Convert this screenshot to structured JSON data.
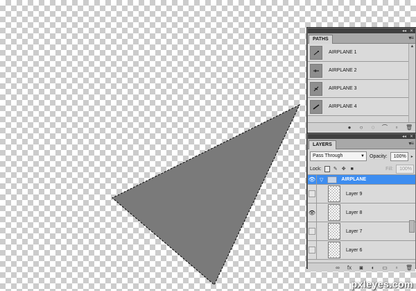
{
  "canvas": {
    "shape_fill": "#7a7a7a",
    "selection_border": "marching-ants"
  },
  "paths_panel": {
    "tab_label": "PATHS",
    "top_icons": "◂◂ ✕",
    "menu_icon": "▾≡",
    "items": [
      {
        "label": "AIRPLANE 1"
      },
      {
        "label": "AIRPLANE 2"
      },
      {
        "label": "AIRPLANE 3"
      },
      {
        "label": "AIRPLANE 4"
      }
    ],
    "footer_icons": [
      "fill-path-icon",
      "stroke-path-icon",
      "load-selection-icon",
      "make-work-path-icon",
      "new-path-icon",
      "delete-path-icon"
    ]
  },
  "layers_panel": {
    "tab_label": "LAYERS",
    "top_icons": "◂◂ ✕",
    "menu_icon": "▾≡",
    "blend_mode": "Pass Through",
    "opacity_label": "Opacity:",
    "opacity_value": "100%",
    "lock_label": "Lock:",
    "fill_label": "Fill:",
    "fill_value": "100%",
    "group": {
      "name": "AIRPLANE",
      "visible": true
    },
    "layers": [
      {
        "name": "Layer 9",
        "visible": false
      },
      {
        "name": "Layer 8",
        "visible": true
      },
      {
        "name": "Layer 7",
        "visible": false
      },
      {
        "name": "Layer 6",
        "visible": false
      }
    ],
    "footer_icons": [
      "link-layers-icon",
      "layer-style-icon",
      "layer-mask-icon",
      "adjustment-layer-icon",
      "new-group-icon",
      "new-layer-icon",
      "delete-layer-icon"
    ]
  },
  "watermark": "pxleyes.com"
}
